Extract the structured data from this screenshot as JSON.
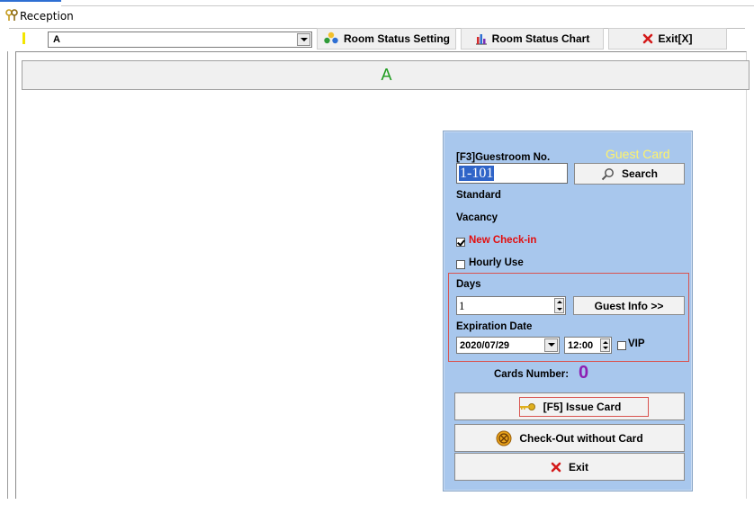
{
  "window": {
    "title": "Reception"
  },
  "toolbar": {
    "building_value": "A",
    "room_status_setting_label": "Room Status Setting",
    "room_status_chart_label": "Room Status Chart",
    "exit_label": "Exit[X]"
  },
  "main": {
    "building_header": "A"
  },
  "card": {
    "guestroom_label": "[F3]Guestroom No.",
    "title": "Guest Card",
    "room_number": "1-101",
    "search_label": "Search",
    "room_type": "Standard",
    "room_status": "Vacancy",
    "new_checkin_label": "New Check-in",
    "new_checkin_checked": true,
    "hourly_use_label": "Hourly Use",
    "hourly_use_checked": false,
    "days_label": "Days",
    "days_value": "1",
    "guest_info_label": "Guest Info >>",
    "expiration_label": "Expiration Date",
    "expiration_date": "2020/07/29",
    "expiration_time": "12:00",
    "vip_label": "VIP",
    "vip_checked": false,
    "cards_number_label": "Cards Number:",
    "cards_number_value": "0",
    "issue_card_label": "[F5] Issue Card",
    "checkout_without_card_label": "Check-Out without Card",
    "exit_label": "Exit"
  },
  "colors": {
    "panel_background": "#a8c7ed",
    "guest_card_title": "#fff36b",
    "new_checkin": "#e30d0d",
    "cards_number": "#8d1fb2",
    "header_text": "#1f9c1f"
  },
  "icons": {
    "app": "keys-icon",
    "room_status_setting": "people-icon",
    "room_status_chart": "bar-chart-icon",
    "toolbar_exit": "red-x-icon",
    "search": "magnifier-icon",
    "issue_card": "key-icon",
    "checkout": "checkout-badge-icon",
    "exit": "red-x-icon"
  }
}
